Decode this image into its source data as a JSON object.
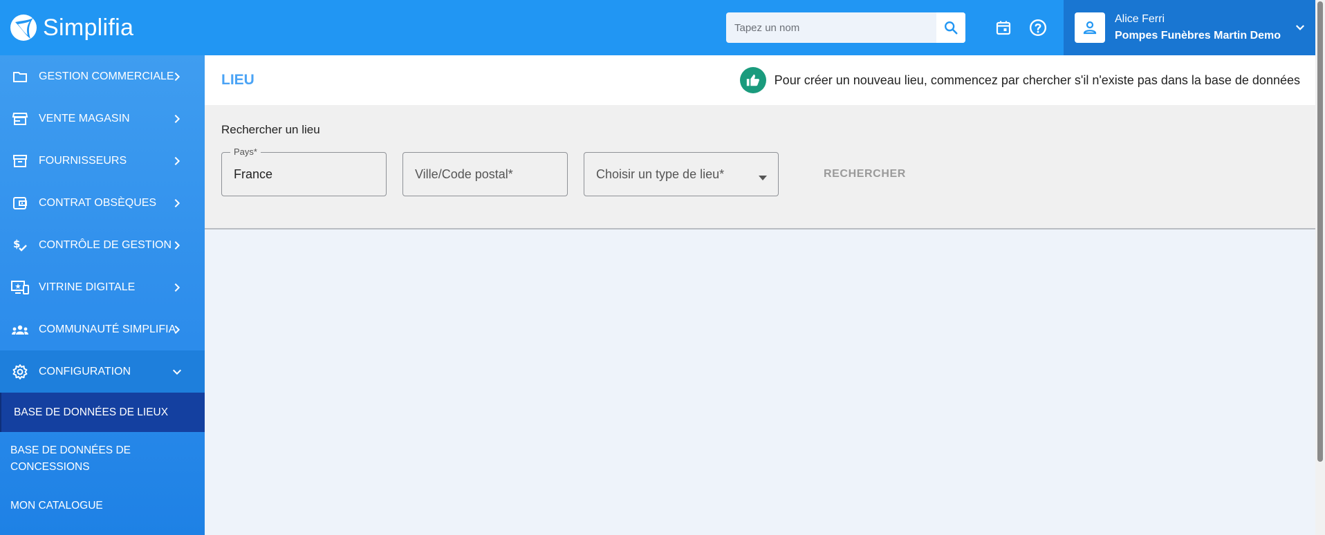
{
  "app": {
    "name": "Simplifia"
  },
  "topbar": {
    "search_placeholder": "Tapez un nom",
    "icons": [
      "search-icon",
      "calendar-icon",
      "help-icon",
      "person-icon",
      "chevron-down-icon"
    ],
    "user": {
      "name": "Alice Ferri",
      "company": "Pompes Funèbres Martin Demo"
    }
  },
  "sidebar": {
    "items": [
      {
        "label": "GESTION COMMERCIALE",
        "icon": "folder-icon"
      },
      {
        "label": "VENTE MAGASIN",
        "icon": "store-icon"
      },
      {
        "label": "FOURNISSEURS",
        "icon": "archive-icon"
      },
      {
        "label": "CONTRAT OBSÈQUES",
        "icon": "wallet-icon"
      },
      {
        "label": "CONTRÔLE DE GESTION",
        "icon": "price-check-icon"
      },
      {
        "label": "VITRINE DIGITALE",
        "icon": "devices-icon"
      },
      {
        "label": "COMMUNAUTÉ SIMPLIFIA",
        "icon": "groups-icon"
      },
      {
        "label": "CONFIGURATION",
        "icon": "gear-icon"
      }
    ],
    "sub_items": [
      {
        "label": "BASE DE DONNÉES DE LIEUX"
      },
      {
        "label": "BASE DE DONNÉES DE CONCESSIONS"
      },
      {
        "label": "MON CATALOGUE"
      }
    ]
  },
  "page": {
    "title": "LIEU",
    "hint": "Pour créer un nouveau lieu, commencez par chercher s'il n'existe pas dans la base de données",
    "hint_icon": "thumb-up-icon",
    "search_panel": {
      "title": "Rechercher un lieu",
      "country_label": "Pays*",
      "country_value": "France",
      "city_placeholder": "Ville/Code postal*",
      "type_placeholder": "Choisir un type de lieu*",
      "search_button": "RECHERCHER"
    }
  },
  "colors": {
    "topbar": "#2196f3",
    "user_panel": "#1976d2",
    "sidebar_active": "#1440a0",
    "title_blue": "#4aa3f5",
    "hint_green": "#1a9b7d"
  }
}
